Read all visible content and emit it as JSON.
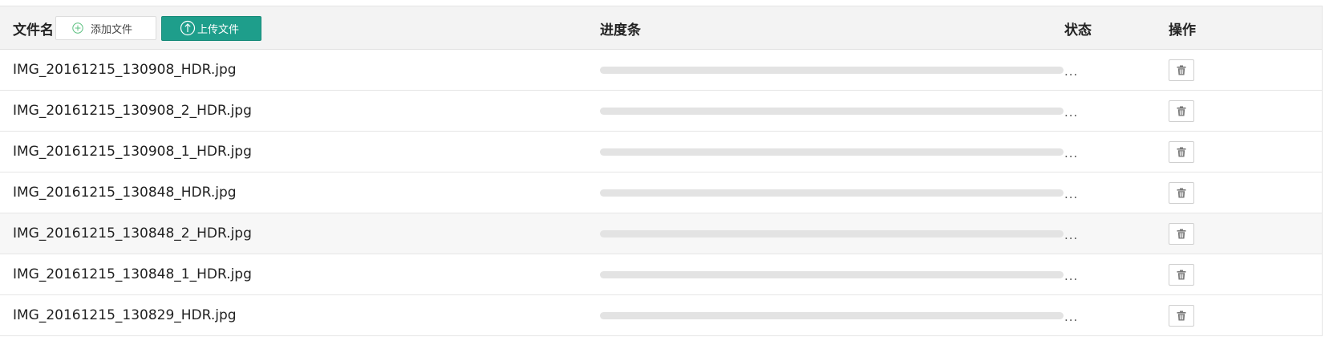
{
  "header": {
    "filename_label": "文件名",
    "add_button_label": "添加文件",
    "upload_button_label": "上传文件",
    "progress_label": "进度条",
    "status_label": "状态",
    "operation_label": "操作"
  },
  "colors": {
    "accent": "#1e9e8b",
    "header_bg": "#f3f3f3",
    "progress_track": "#e3e3e3"
  },
  "icons": {
    "add": "plus-circle-icon",
    "upload": "upload-circle-icon",
    "delete": "trash-icon"
  },
  "files": [
    {
      "name": "IMG_20161215_130908_HDR.jpg",
      "progress": 0,
      "status": "..."
    },
    {
      "name": "IMG_20161215_130908_2_HDR.jpg",
      "progress": 0,
      "status": "..."
    },
    {
      "name": "IMG_20161215_130908_1_HDR.jpg",
      "progress": 0,
      "status": "..."
    },
    {
      "name": "IMG_20161215_130848_HDR.jpg",
      "progress": 0,
      "status": "..."
    },
    {
      "name": "IMG_20161215_130848_2_HDR.jpg",
      "progress": 0,
      "status": "..."
    },
    {
      "name": "IMG_20161215_130848_1_HDR.jpg",
      "progress": 0,
      "status": "..."
    },
    {
      "name": "IMG_20161215_130829_HDR.jpg",
      "progress": 0,
      "status": "..."
    }
  ]
}
